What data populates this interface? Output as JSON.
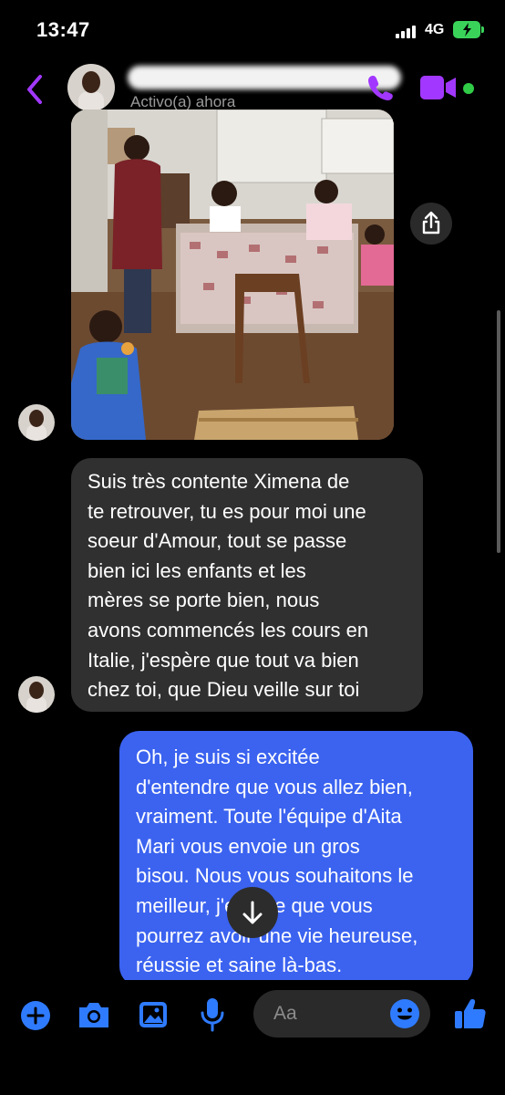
{
  "status_bar": {
    "time": "13:47",
    "network": "4G"
  },
  "header": {
    "back_icon": "chevron-left-icon",
    "contact_status": "Activo(a) ahora",
    "call_icon": "phone-icon",
    "video_icon": "video-camera-icon",
    "accent_color": "#a238ff",
    "active_color": "#31cc47"
  },
  "thread": {
    "incoming_message": {
      "lines": [
        "Suis très contente Ximena de",
        "te retrouver, tu es pour moi une",
        "soeur d'Amour, tout se passe",
        "bien ici  les enfants et les",
        "mères se porte bien, nous",
        "avons commencés les cours en",
        "Italie, j'espère que tout va bien",
        "chez toi, que Dieu veille sur toi"
      ],
      "bubble_color": "#303030"
    },
    "outgoing_message": {
      "lines": [
        "Oh, je suis si excitée",
        "d'entendre que vous allez bien,",
        "vraiment. Toute l'équipe d'Aita",
        "Mari vous envoie un gros",
        "bisou. Nous vous souhaitons le",
        "meilleur, j'espère que vous",
        "pourrez avoir une vie heureuse,",
        "réussie et saine là-bas."
      ],
      "bubble_color": "#3b63f0"
    }
  },
  "composer": {
    "placeholder": "Aa",
    "icon_color": "#2f7bff",
    "icons": [
      "plus-icon",
      "camera-icon",
      "image-icon",
      "microphone-icon",
      "emoji-icon",
      "thumbs-up-icon"
    ]
  }
}
